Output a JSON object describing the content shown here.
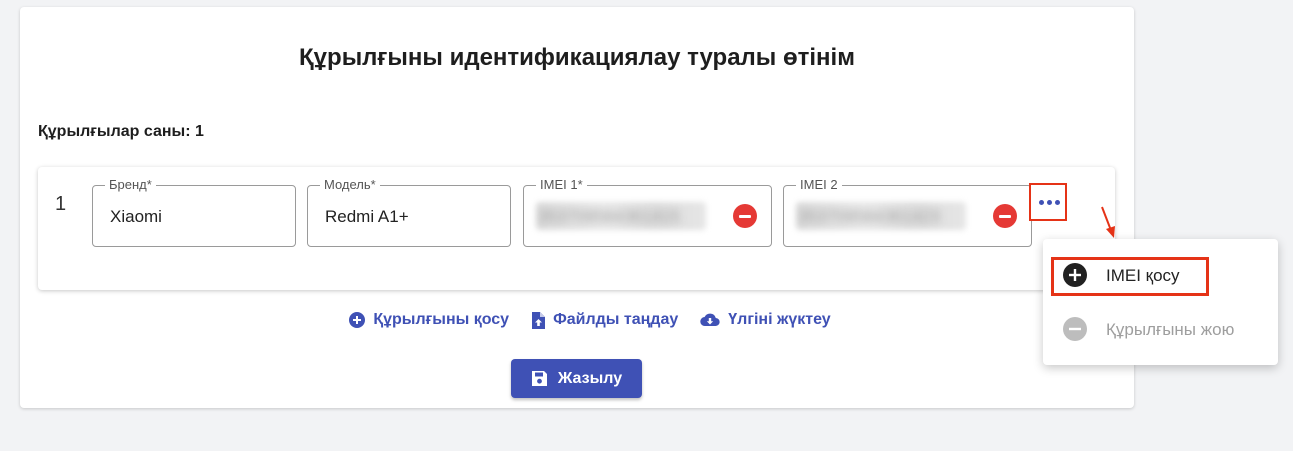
{
  "page": {
    "title": "Құрылғыны идентификациялау туралы өтінім",
    "device_count_label": "Құрылғылар саны: 1"
  },
  "device_row": {
    "number": "1",
    "brand": {
      "label": "Бренд*",
      "value": "Xiaomi"
    },
    "model": {
      "label": "Модель*",
      "value": "Redmi A1+"
    },
    "imei1": {
      "label": "IMEI 1*",
      "value_redacted": "353709584361415"
    },
    "imei2": {
      "label": "IMEI 2",
      "value_redacted": "353709584361423"
    }
  },
  "actions": {
    "add_device": "Құрылғыны қосу",
    "choose_file": "Файлды таңдау",
    "download_template": "Үлгіні жүктеу"
  },
  "save_button": "Жазылу",
  "context_menu": {
    "add_imei": "IMEI қосу",
    "remove_device": "Құрылғыны жою"
  },
  "colors": {
    "accent": "#3f51b5",
    "remove": "#e53935",
    "highlight": "#e53317",
    "disabled": "#9e9e9e"
  }
}
